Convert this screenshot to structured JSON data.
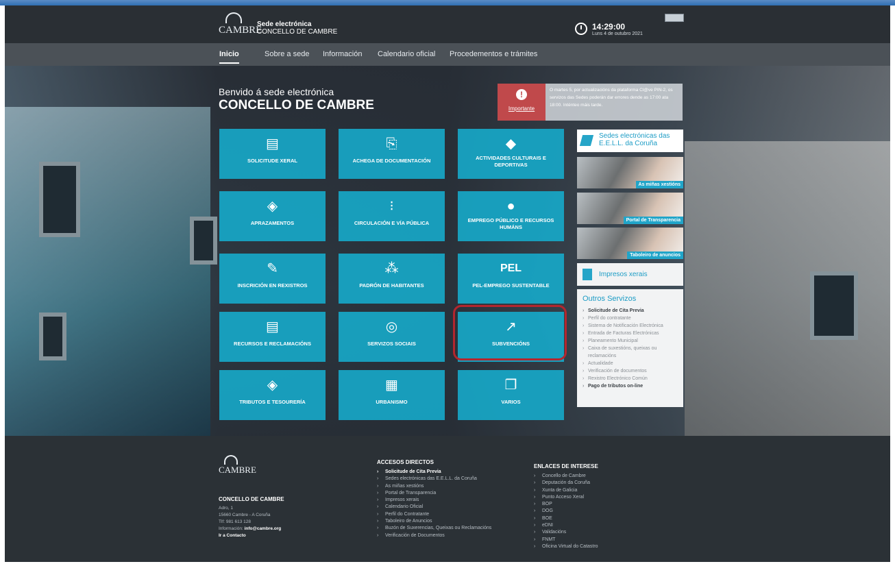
{
  "header": {
    "logo_name": "CAMBRE",
    "logo_line1": "Sede electrónica",
    "logo_line2": "CONCELLO DE CAMBRE",
    "time": "14:29:00",
    "date": "Luns 4 de outubro 2021"
  },
  "nav": {
    "items": [
      {
        "label": "Inicio"
      },
      {
        "label": "Sobre a sede"
      },
      {
        "label": "Información"
      },
      {
        "label": "Calendario oficial"
      },
      {
        "label": "Procedementos e trámites"
      }
    ]
  },
  "hero": {
    "welcome": "Benvido á sede electrónica",
    "title": "CONCELLO DE CAMBRE"
  },
  "notice": {
    "label": "Importante",
    "text": "O martes 5, por actualizacións da plataforma Cl@ve PIN-2, os servizos das Sedes poderán dar errores dende as 17:00 ata 18:00. Inténteo máis tarde."
  },
  "tiles": [
    {
      "label": "SOLICITUDE XERAL",
      "icon": "document-icon"
    },
    {
      "label": "ACHEGA DE DOCUMENTACIÓN",
      "icon": "attach-icon"
    },
    {
      "label": "ACTIVIDADES CULTURAIS E DEPORTIVAS",
      "icon": "ticket-icon"
    },
    {
      "label": "APRAZAMENTOS",
      "icon": "calculator-icon"
    },
    {
      "label": "CIRCULACIÓN E VÍA PÚBLICA",
      "icon": "traffic-light-icon"
    },
    {
      "label": "EMPREGO PÚBLICO E RECURSOS HUMÁNS",
      "icon": "user-icon"
    },
    {
      "label": "INSCRICIÓN EN REXISTROS",
      "icon": "edit-icon"
    },
    {
      "label": "PADRÓN DE HABITANTES",
      "icon": "people-icon"
    },
    {
      "label": "PEL-EMPREGO SUSTENTABLE",
      "icon": "pel-icon",
      "icon_text": "PEL"
    },
    {
      "label": "RECURSOS E RECLAMACIÓNS",
      "icon": "document-search-icon"
    },
    {
      "label": "SERVIZOS SOCIAIS",
      "icon": "social-icon"
    },
    {
      "label": "SUBVENCIÓNS",
      "icon": "chart-icon"
    },
    {
      "label": "TRIBUTOS E TESOURERÍA",
      "icon": "calculator-icon"
    },
    {
      "label": "URBANISMO",
      "icon": "building-icon"
    },
    {
      "label": "VARIOS",
      "icon": "files-icon"
    }
  ],
  "sidebar": {
    "sedes": "Sedes electrónicas das E.E.L.L. da Coruña",
    "banners": [
      "As miñas xestións",
      "Portal de Transparencia",
      "Taboleiro de anuncios"
    ],
    "impresos": "Impresos xerais",
    "outros_title": "Outros Servizos",
    "outros": [
      {
        "label": "Solicitude de Cita Previa",
        "bold": true
      },
      {
        "label": "Perfil do contratante"
      },
      {
        "label": "Sistema de Notificación Electrónica"
      },
      {
        "label": "Entrada de Facturas Electrónicas"
      },
      {
        "label": "Planeamento Municipal"
      },
      {
        "label": "Caixa de suxestións, queixas ou reclamacións"
      },
      {
        "label": "Actualidade"
      },
      {
        "label": "Verificación de documentos"
      },
      {
        "label": "Rexistro Electrónico Común"
      },
      {
        "label": "Pago de tributos on-line",
        "bold": true
      }
    ]
  },
  "footer": {
    "logo_name": "CAMBRE",
    "org": "CONCELLO DE CAMBRE",
    "addr1": "Adro, 1",
    "addr2": "15660 Cambre - A Coruña",
    "phone": "Tlf: 981 613 128",
    "info_label": "Información: ",
    "info_email": "info@cambre.org",
    "contact": "Ir a Contacto",
    "accesos_title": "ACCESOS DIRECTOS",
    "accesos": [
      {
        "label": "Solicitude de Cita Previa",
        "bold": true
      },
      {
        "label": "Sedes electrónicas das E.E.L.L. da Coruña"
      },
      {
        "label": "As miñas xestións"
      },
      {
        "label": "Portal de Transparencia"
      },
      {
        "label": "Impresos xerais"
      },
      {
        "label": "Calendario Oficial"
      },
      {
        "label": "Perfil do Contratante"
      },
      {
        "label": "Taboleiro de Anuncios"
      },
      {
        "label": "Buzón de Suxerencias, Queixas ou Reclamacións"
      },
      {
        "label": "Verificación de Documentos"
      }
    ],
    "enlaces_title": "ENLACES DE INTERESE",
    "enlaces": [
      {
        "label": "Concello de Cambre"
      },
      {
        "label": "Deputación da Coruña"
      },
      {
        "label": "Xunta de Galicia"
      },
      {
        "label": "Punto Acceso Xeral"
      },
      {
        "label": "BOP"
      },
      {
        "label": "DOG"
      },
      {
        "label": "BOE"
      },
      {
        "label": "eDNI"
      },
      {
        "label": "Validacións"
      },
      {
        "label": "FNMT"
      },
      {
        "label": "Oficina Virtual do Catastro"
      }
    ]
  },
  "colors": {
    "accent": "#16AACA",
    "notice": "#C0494B",
    "highlight": "#B3262E",
    "dark": "#2B3136"
  }
}
